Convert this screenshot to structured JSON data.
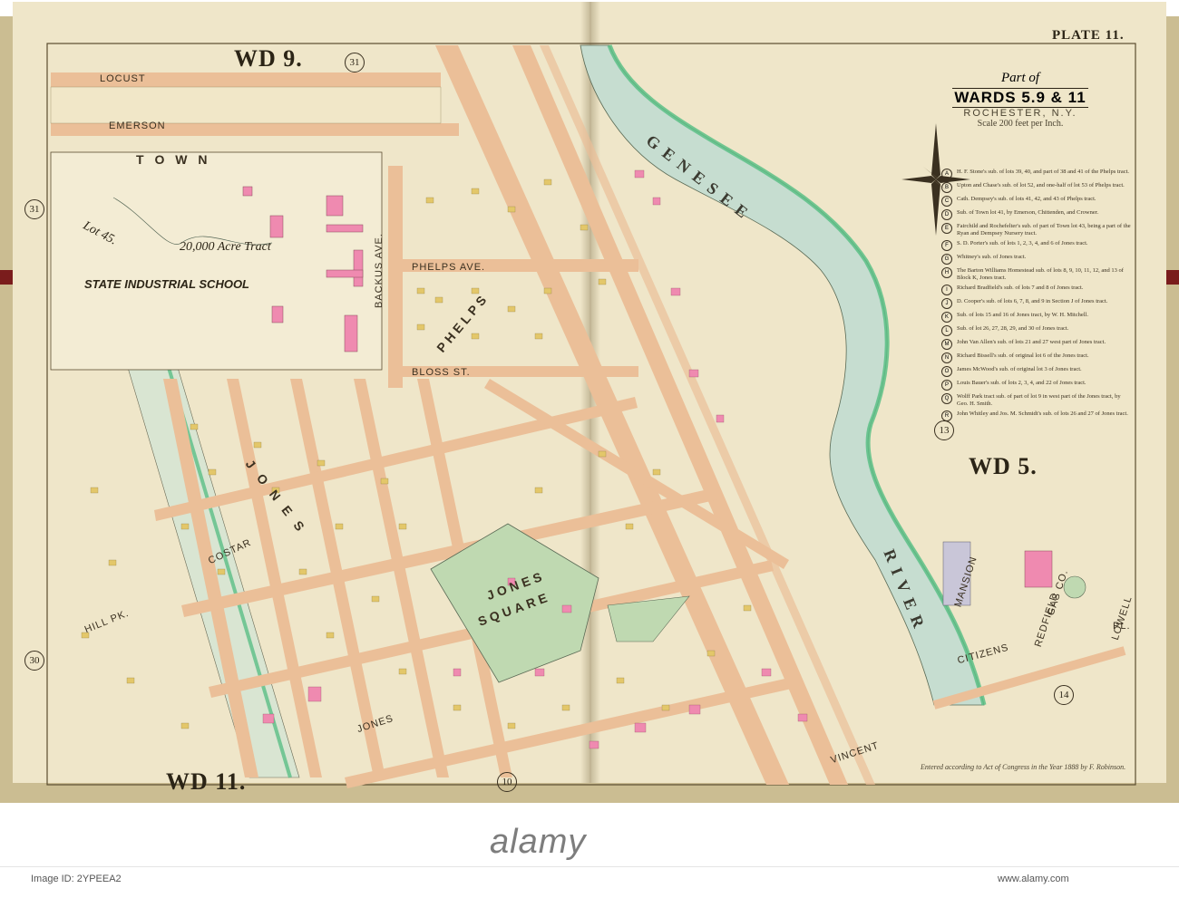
{
  "plate": {
    "plate_number": "PLATE 11.",
    "ward_labels": [
      "WD 9.",
      "WD 5.",
      "WD 11."
    ],
    "lot_circles": [
      "31",
      "31",
      "30",
      "10",
      "13",
      "14"
    ]
  },
  "title_block": {
    "part_of": "Part of",
    "wards": "WARDS 5.9 & 11",
    "city": "ROCHESTER, N.Y.",
    "scale": "Scale 200 feet per Inch."
  },
  "streets": {
    "locust": "LOCUST",
    "emerson": "EMERSON",
    "phelps_ave": "PHELPS AVE.",
    "bloss_st": "BLOSS ST.",
    "backus_ave": "BACKUS AVE.",
    "jones": "JONES",
    "costar": "COSTAR",
    "vincent": "VINCENT",
    "hill_pk": "HILL PK.",
    "mansion": "MANSION",
    "redfield": "REDFIELD",
    "lowell": "LOWELL",
    "citizens": "CITIZENS",
    "pl": "PL."
  },
  "areas": {
    "lot_45": "Lot 45.",
    "acre_tract": "20,000 Acre Tract",
    "state_industrial_school": "STATE INDUSTRIAL SCHOOL",
    "jones_square_1": "JONES",
    "jones_square_2": "SQUARE",
    "town_lot": "T O W N",
    "phelps_tract": "PHELPS",
    "jones_tract": "J O N E S",
    "genesee": "G E N E S E E",
    "river": "R I V E R",
    "gas_co": "GAS CO."
  },
  "legend": [
    {
      "key": "A",
      "text": "H. F. Stone's sub. of lots 39, 40, and part of 38 and 41 of the Phelps tract."
    },
    {
      "key": "B",
      "text": "Upton and Chase's sub. of lot 52, and one-half of lot 53 of Phelps tract."
    },
    {
      "key": "C",
      "text": "Cath. Dempsey's sub. of lots 41, 42, and 43 of Phelps tract."
    },
    {
      "key": "D",
      "text": "Sub. of Town lot 41, by Emerson, Chittenden, and Crowner."
    },
    {
      "key": "E",
      "text": "Fairchild and Rochefelter's sub. of part of Town lot 43, being a part of the Ryan and Dempsey Nursery tract."
    },
    {
      "key": "F",
      "text": "S. D. Porter's sub. of lots 1, 2, 3, 4, and 6 of Jones tract."
    },
    {
      "key": "G",
      "text": "Whitney's sub. of Jones tract."
    },
    {
      "key": "H",
      "text": "The Barton Williams Homestead sub. of lots 8, 9, 10, 11, 12, and 13 of Block K, Jones tract."
    },
    {
      "key": "I",
      "text": "Richard Bradfield's sub. of lots 7 and 8 of Jones tract."
    },
    {
      "key": "J",
      "text": "D. Cooper's sub. of lots 6, 7, 8, and 9 in Section J of Jones tract."
    },
    {
      "key": "K",
      "text": "Sub. of lots 15 and 16 of Jones tract, by W. H. Mitchell."
    },
    {
      "key": "L",
      "text": "Sub. of lot 26, 27, 28, 29, and 30 of Jones tract."
    },
    {
      "key": "M",
      "text": "John Van Allen's sub. of lots 21 and 27 west part of Jones tract."
    },
    {
      "key": "N",
      "text": "Richard Bissell's sub. of original lot 6 of the Jones tract."
    },
    {
      "key": "O",
      "text": "James McWood's sub. of original lot 3 of Jones tract."
    },
    {
      "key": "P",
      "text": "Louis Bauer's sub. of lots 2, 3, 4, and 22 of Jones tract."
    },
    {
      "key": "Q",
      "text": "Wolff Park tract sub. of part of lot 9 in west part of the Jones tract, by Geo. H. Smith."
    },
    {
      "key": "R",
      "text": "John Whitley and Jos. M. Schmidt's sub. of lots 26 and 27 of Jones tract."
    }
  ],
  "copyright": "Entered according to Act of Congress in the Year 1888 by F. Robinson.",
  "watermark": {
    "brand": "alamy",
    "image_id": "Image ID: 2YPEEA2",
    "site": "www.alamy.com"
  },
  "colors": {
    "paper": "#efe6c9",
    "street": "#ebbf98",
    "pink": "#ef8ab0",
    "yellow": "#e3c76a",
    "park_green": "#bfd9b1",
    "river_blue": "#c6ddd0",
    "river_green": "#5bbf86"
  }
}
